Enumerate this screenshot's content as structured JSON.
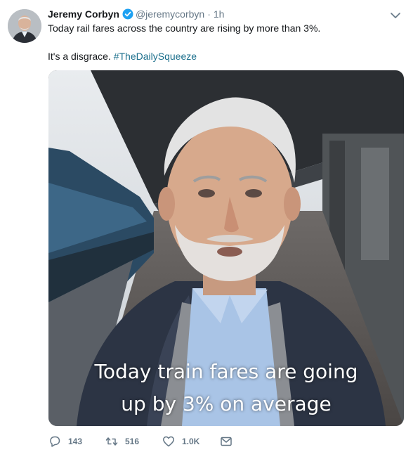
{
  "tweet": {
    "display_name": "Jeremy Corbyn",
    "handle": "@jeremycorbyn",
    "separator": "·",
    "time": "1h",
    "text_line1": "Today rail fares across the country are rising by more than 3%.",
    "text_line2_prefix": "It's a disgrace. ",
    "hashtag": "#TheDailySqueeze",
    "hashtag_color": "#1b6f8c",
    "verified_color": "#1da1f2"
  },
  "media": {
    "caption_line1": "Today train fares are going",
    "caption_line2": "up by 3% on average"
  },
  "actions": {
    "replies": "143",
    "retweets": "516",
    "likes": "1.0K",
    "icons": [
      "reply-icon",
      "retweet-icon",
      "like-icon",
      "direct-message-icon"
    ]
  }
}
